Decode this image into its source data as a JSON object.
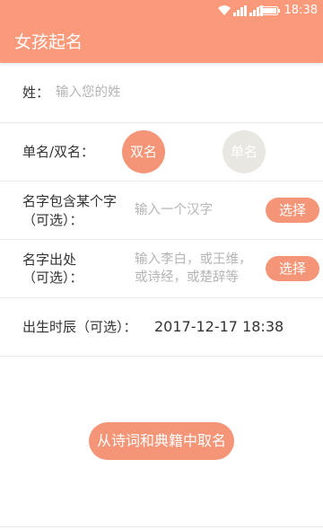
{
  "status_bar": {
    "time": "18:38",
    "icons": [
      "wifi-icon",
      "signal-icon",
      "signal-icon",
      "battery-icon"
    ]
  },
  "app_bar": {
    "title": "女孩起名"
  },
  "form": {
    "surname": {
      "label": "姓：",
      "placeholder": "输入您的姓"
    },
    "name_type": {
      "label": "单名/双名：",
      "options": [
        "双名",
        "单名"
      ],
      "selected": "双名"
    },
    "contains_char": {
      "label_line1": "名字包含某个字",
      "label_line2": "（可选）：",
      "placeholder": "输入一个汉字",
      "button": "选择"
    },
    "source": {
      "label_line1": "名字出处",
      "label_line2": "（可选）：",
      "hint_line1": "输入李白，或王维，",
      "hint_line2": "或诗经，或楚辞等",
      "button": "选择"
    },
    "birth": {
      "label": "出生时辰（可选）：",
      "value": "2017-12-17 18:38"
    }
  },
  "action": {
    "label": "从诗词和典籍中取名"
  },
  "colors": {
    "accent": "#fb9a7b",
    "button": "#f49577",
    "inactive_circle": "#e9e7e2",
    "hint_text": "#b5b5b5"
  }
}
